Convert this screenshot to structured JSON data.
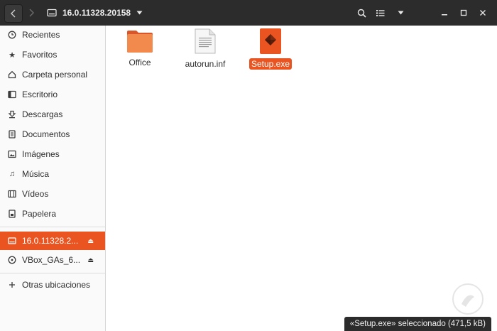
{
  "header": {
    "back_icon": "chevron-left-icon",
    "forward_icon": "chevron-right-icon",
    "location_title": "16.0.11328.20158",
    "location_icon": "drive-icon",
    "dropdown_icon": "triangle-down-icon",
    "search_icon": "search-icon",
    "view_icon": "list-view-icon",
    "view_dropdown_icon": "triangle-down-icon",
    "minimize_icon": "minimize-icon",
    "maximize_icon": "maximize-icon",
    "close_icon": "close-icon"
  },
  "sidebar": {
    "items": [
      {
        "label": "Recientes",
        "icon": "clock-icon"
      },
      {
        "label": "Favoritos",
        "icon": "star-icon"
      },
      {
        "label": "Carpeta personal",
        "icon": "home-icon"
      },
      {
        "label": "Escritorio",
        "icon": "desktop-icon"
      },
      {
        "label": "Descargas",
        "icon": "download-icon"
      },
      {
        "label": "Documentos",
        "icon": "document-icon"
      },
      {
        "label": "Imágenes",
        "icon": "image-icon"
      },
      {
        "label": "Música",
        "icon": "music-icon"
      },
      {
        "label": "Vídeos",
        "icon": "video-icon"
      },
      {
        "label": "Papelera",
        "icon": "trash-icon"
      }
    ],
    "devices": [
      {
        "label": "16.0.11328.2...",
        "icon": "drive-icon",
        "active": true
      },
      {
        "label": "VBox_GAs_6...",
        "icon": "disc-icon",
        "active": false
      }
    ],
    "other": {
      "label": "Otras ubicaciones",
      "icon": "plus-icon"
    }
  },
  "files": [
    {
      "name": "Office",
      "type": "folder-icon",
      "selected": false
    },
    {
      "name": "autorun.inf",
      "type": "text-file-icon",
      "selected": false
    },
    {
      "name": "Setup.exe",
      "type": "executable-icon",
      "selected": true
    }
  ],
  "status": {
    "text": "«Setup.exe» seleccionado  (471,5 kB)"
  },
  "colors": {
    "accent": "#e95420",
    "header": "#2c2c2c"
  }
}
